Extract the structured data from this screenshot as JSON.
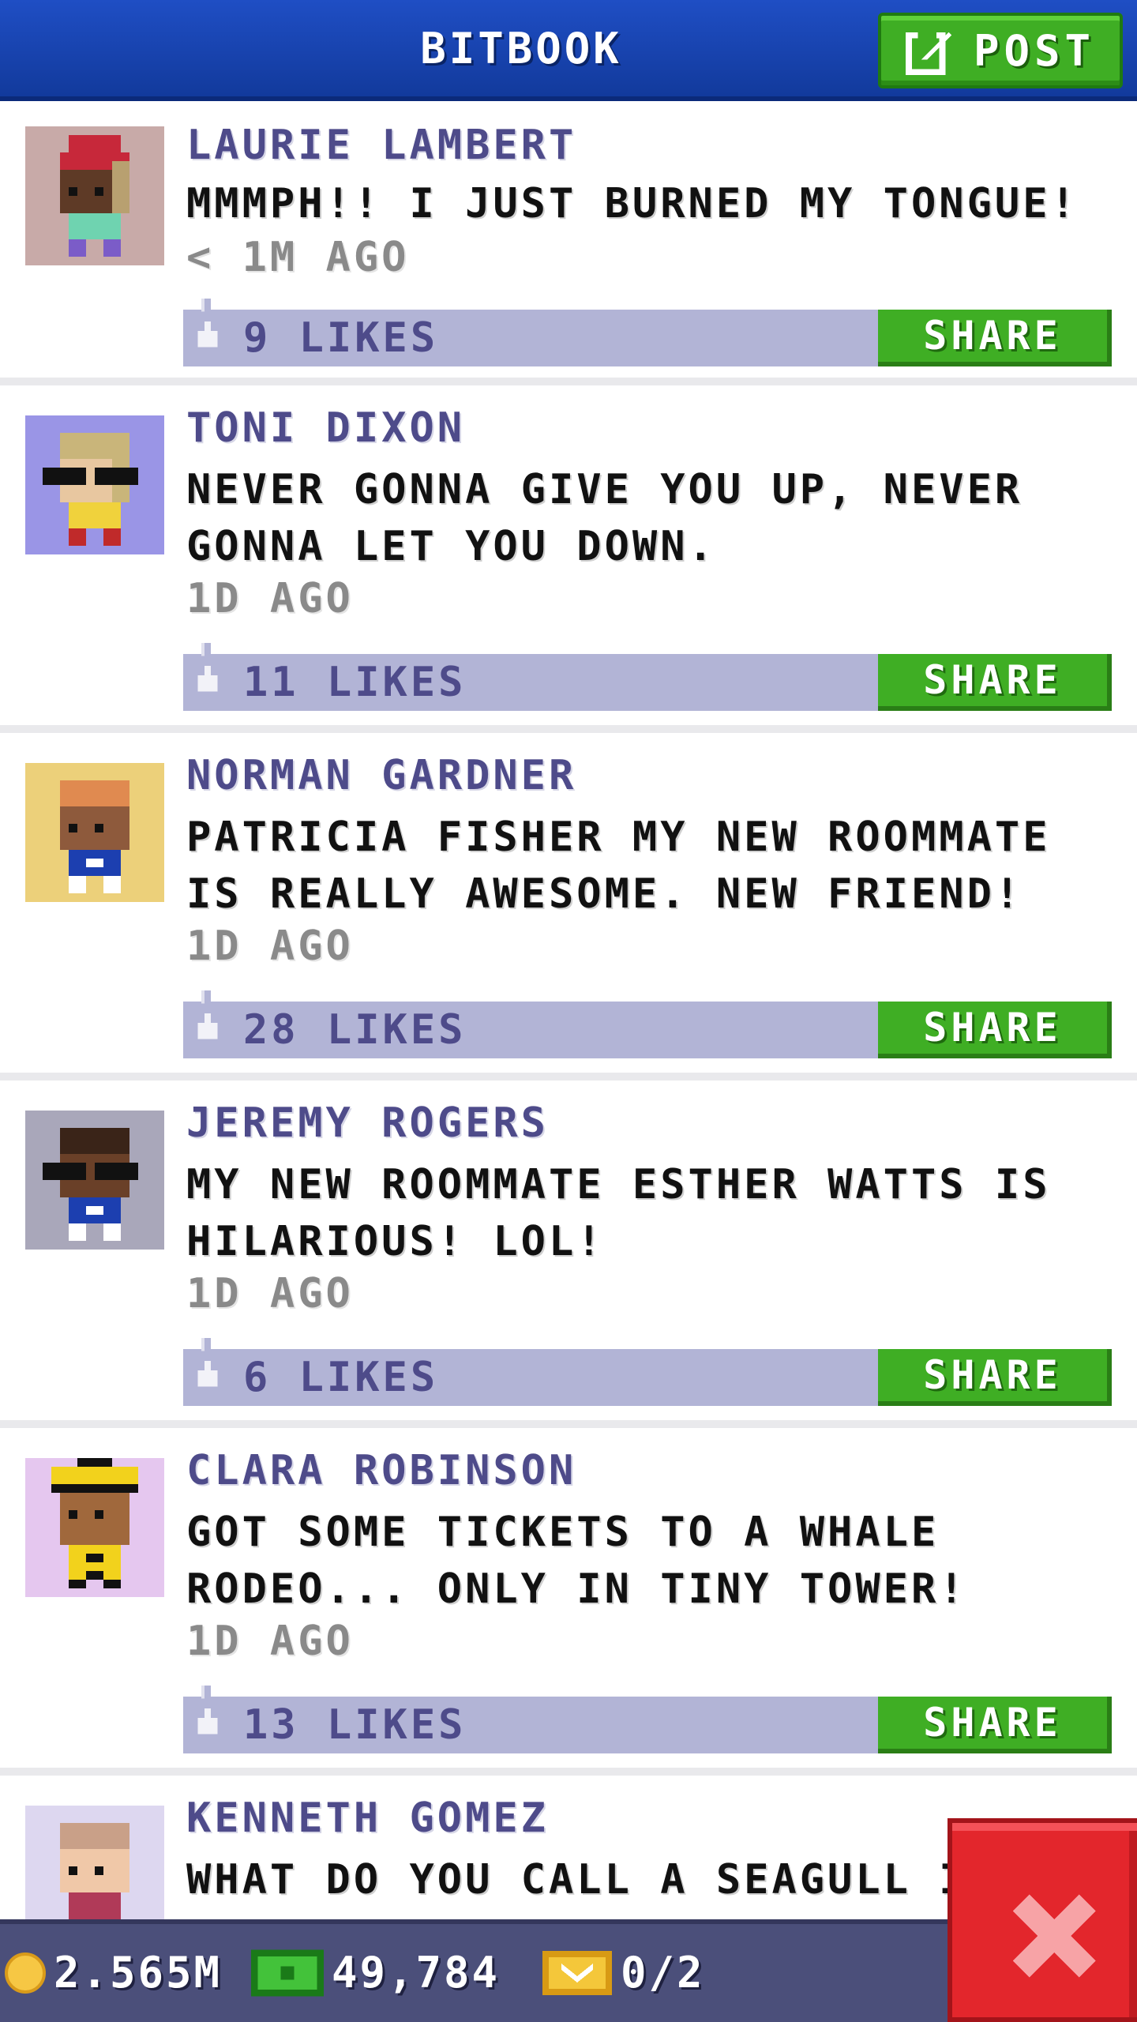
{
  "header": {
    "title": "BITBOOK",
    "post_label": "POST"
  },
  "posts": [
    {
      "name": "LAURIE LAMBERT",
      "message": "MMMPH!! I JUST BURNED MY TONGUE!",
      "time": "< 1M AGO",
      "likes": "9 LIKES",
      "share": "SHARE",
      "avatar_bg": "#c8aaa8"
    },
    {
      "name": "TONI DIXON",
      "message": "NEVER GONNA GIVE YOU UP, NEVER GONNA LET YOU DOWN.",
      "time": "1D AGO",
      "likes": "11 LIKES",
      "share": "SHARE",
      "avatar_bg": "#9a95e6"
    },
    {
      "name": "NORMAN GARDNER",
      "message": "PATRICIA FISHER MY NEW ROOMMATE IS REALLY AWESOME. NEW FRIEND!",
      "time": "1D AGO",
      "likes": "28 LIKES",
      "share": "SHARE",
      "avatar_bg": "#ecd07a"
    },
    {
      "name": "JEREMY ROGERS",
      "message": "MY NEW ROOMMATE ESTHER WATTS IS HILARIOUS! LOL!",
      "time": "1D AGO",
      "likes": "6 LIKES",
      "share": "SHARE",
      "avatar_bg": "#a9a7ba"
    },
    {
      "name": "CLARA ROBINSON",
      "message": "GOT SOME TICKETS TO A WHALE RODEO... ONLY IN TINY TOWER!",
      "time": "1D AGO",
      "likes": "13 LIKES",
      "share": "SHARE",
      "avatar_bg": "#e5c7ef"
    },
    {
      "name": "KENNETH GOMEZ",
      "message": "WHAT DO YOU CALL A SEAGULL I",
      "avatar_bg": "#ddd7f0"
    }
  ],
  "status": {
    "coins": "2.565M",
    "bux": "49,784",
    "tickets": "0/2"
  },
  "colors": {
    "header": "#1a46b4",
    "accent_green": "#3fae24",
    "like_bar": "#b2b4d6",
    "name_text": "#4e4b8a",
    "close_red": "#e3262c"
  },
  "icons": {
    "post": "edit-icon",
    "like": "thumbs-up-icon",
    "close": "close-icon",
    "coin": "coin-icon",
    "bux": "bux-icon",
    "ticket": "ticket-icon"
  }
}
